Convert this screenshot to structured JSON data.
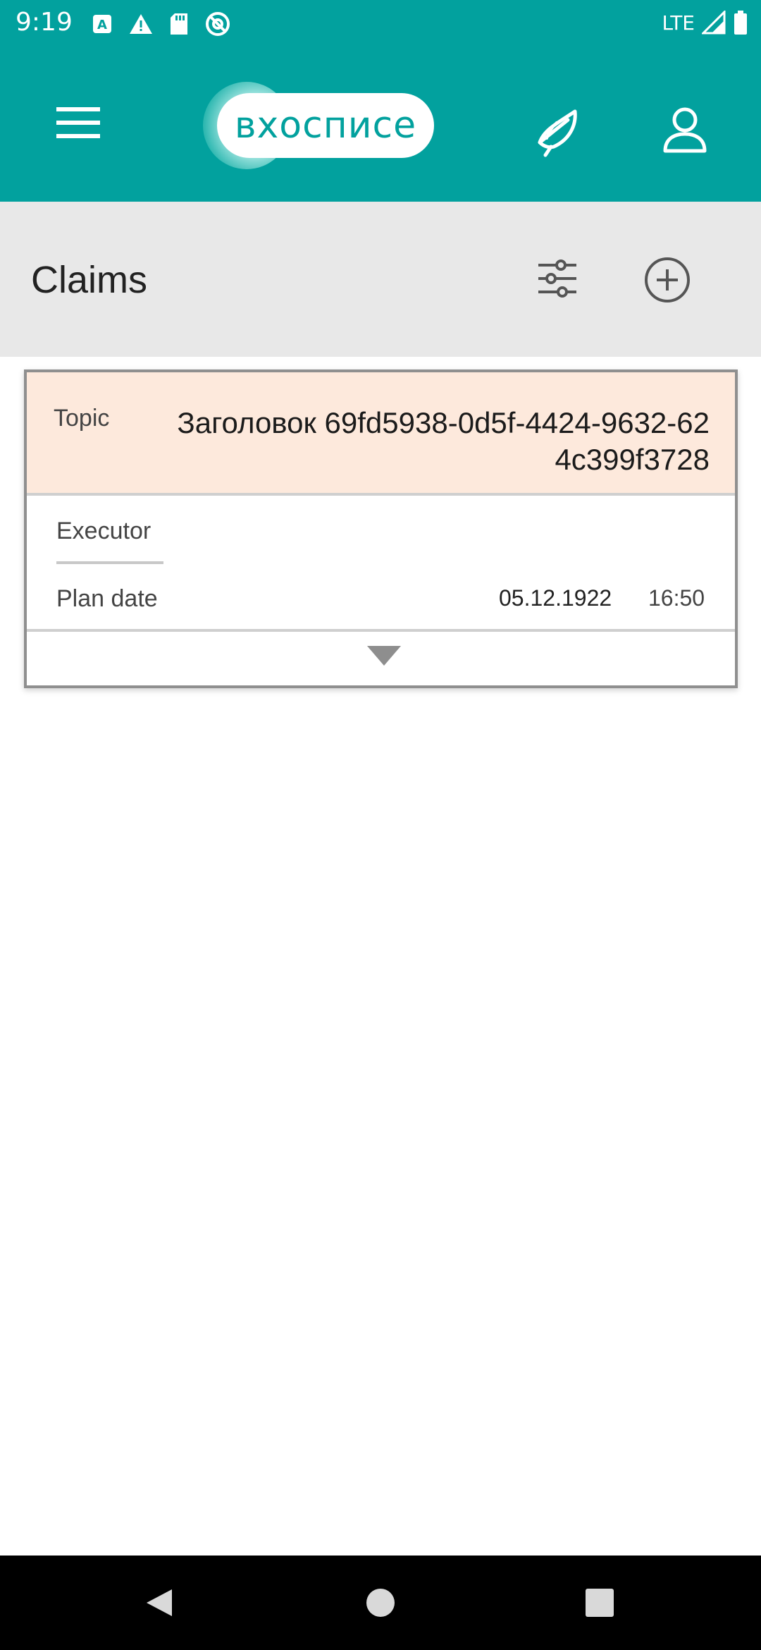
{
  "status_bar": {
    "time": "9:19",
    "network": "LTE",
    "icons": [
      "a-notification-icon",
      "warning-icon",
      "sd-card-icon",
      "sync-icon",
      "signal-icon",
      "battery-icon"
    ]
  },
  "app_bar": {
    "logo_text": "вхосписе",
    "icons": [
      "menu-icon",
      "feather-icon",
      "profile-icon"
    ]
  },
  "claims": {
    "title": "Claims",
    "icons": [
      "filter-icon",
      "add-circle-icon"
    ]
  },
  "claim_card": {
    "topic_label": "Topic",
    "topic_value": "Заголовок 69fd5938-0d5f-4424-9632-624c399f3728",
    "executor_label": "Executor",
    "plan_date_label": "Plan date",
    "plan_date": "05.12.1922",
    "plan_time": "16:50"
  },
  "nav_bar": {
    "icons": [
      "back-icon",
      "home-icon",
      "recent-apps-icon"
    ]
  },
  "colors": {
    "primary": "#02A19E",
    "header_bg": "#E8E8E8",
    "topic_bg": "#FDE9DC",
    "nav_bg": "#000000"
  }
}
